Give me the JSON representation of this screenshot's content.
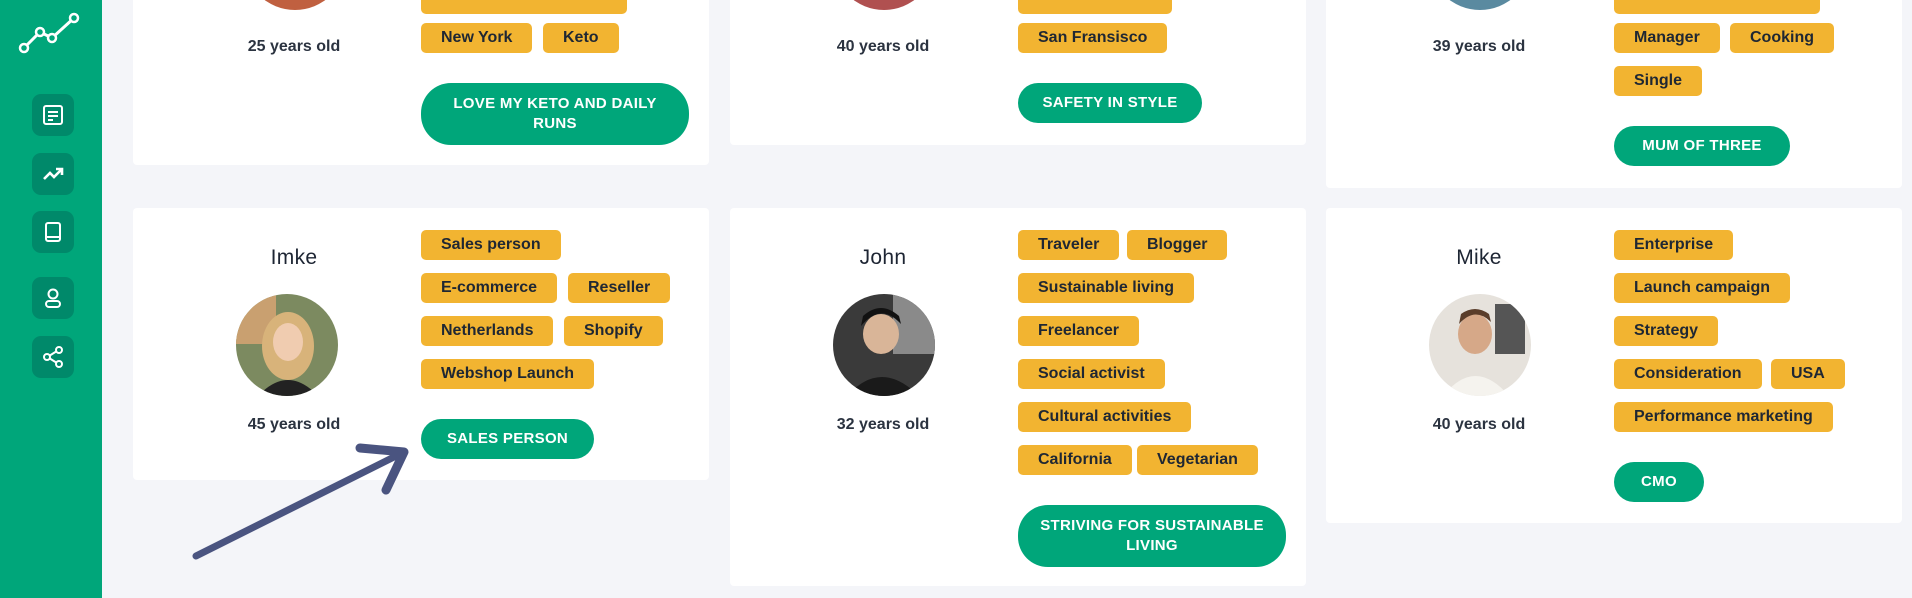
{
  "colors": {
    "accent": "#00a67a",
    "tag": "#f2b431",
    "background": "#f4f5f9",
    "arrow": "#4a5480"
  },
  "sidebar": {
    "icons": [
      "chart-logo-icon",
      "notes-icon",
      "trending-icon",
      "book-icon",
      "user-icon",
      "share-icon"
    ]
  },
  "top_row": [
    {
      "age": "25 years old",
      "tags": [
        "New York",
        "Keto"
      ],
      "cta": "LOVE MY KETO AND DAILY RUNS"
    },
    {
      "age": "40 years old",
      "tags": [
        "San Fransisco"
      ],
      "cta": "SAFETY IN STYLE"
    },
    {
      "age": "39 years old",
      "tags": [
        "Manager",
        "Cooking",
        "Single"
      ],
      "cta": "MUM OF THREE"
    }
  ],
  "bottom_row": [
    {
      "name": "Imke",
      "age": "45 years old",
      "tags": [
        "Sales person",
        "E-commerce",
        "Reseller",
        "Netherlands",
        "Shopify",
        "Webshop Launch"
      ],
      "cta": "SALES PERSON"
    },
    {
      "name": "John",
      "age": "32 years old",
      "tags": [
        "Traveler",
        "Blogger",
        "Sustainable living",
        "Freelancer",
        "Social activist",
        "Cultural activities",
        "California",
        "Vegetarian"
      ],
      "cta": "STRIVING FOR SUSTAINABLE LIVING"
    },
    {
      "name": "Mike",
      "age": "40 years old",
      "tags": [
        "Enterprise",
        "Launch campaign",
        "Strategy",
        "Consideration",
        "USA",
        "Performance marketing"
      ],
      "cta": "CMO"
    }
  ]
}
